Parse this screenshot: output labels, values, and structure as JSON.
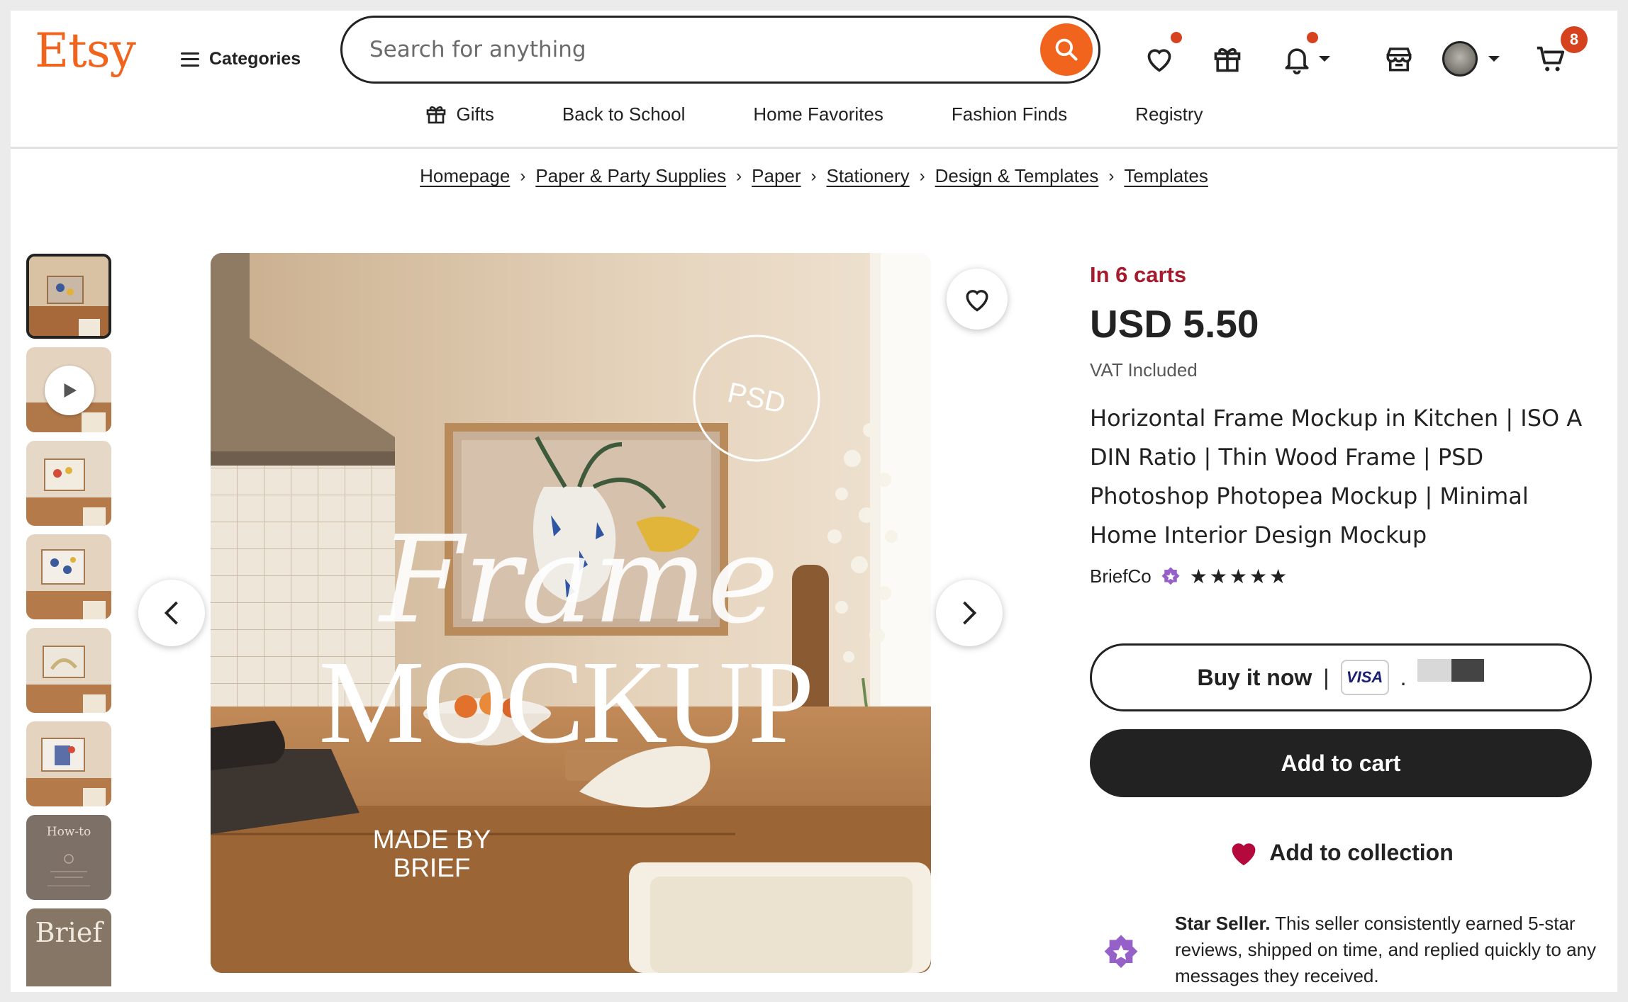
{
  "header": {
    "logo": "Etsy",
    "categories_label": "Categories",
    "search_placeholder": "Search for anything",
    "cart_count": "8"
  },
  "subnav": [
    "Gifts",
    "Back to School",
    "Home Favorites",
    "Fashion Finds",
    "Registry"
  ],
  "breadcrumb": [
    "Homepage",
    "Paper & Party Supplies",
    "Paper",
    "Stationery",
    "Design & Templates",
    "Templates"
  ],
  "listing": {
    "in_carts": "In 6 carts",
    "price": "USD 5.50",
    "vat": "VAT Included",
    "title": "Horizontal Frame Mockup in Kitchen | ISO A DIN Ratio | Thin Wood Frame | PSD Photoshop Photopea Mockup | Minimal Home Interior Design Mockup",
    "shop_name": "BriefCo",
    "rating_stars": 5,
    "buy_now_label": "Buy it now",
    "visa_label": "VISA",
    "add_to_cart_label": "Add to cart",
    "add_to_collection_label": "Add to collection",
    "star_seller_bold": "Star Seller.",
    "star_seller_text": " This seller consistently earned 5-star reviews, shipped on time, and replied quickly to any messages they received."
  },
  "image_overlay": {
    "psd": "PSD",
    "script": "Frame",
    "big": "MOCKUP",
    "made_by": "MADE BY\nBRIEF",
    "thumb7_text": "How-to",
    "thumb8_text": "Brief"
  },
  "colors": {
    "brand_orange": "#F1641E",
    "in_carts_red": "#A61A2E",
    "notification_dot": "#D6411E",
    "star_seller_purple": "#9560C8",
    "heart_red": "#B3093C"
  },
  "icons": [
    "hamburger-icon",
    "search-icon",
    "favorites-heart-icon",
    "gift-icon",
    "bell-icon",
    "shop-icon",
    "avatar",
    "cart-icon",
    "chevron-down-icon",
    "chevron-left-icon",
    "chevron-right-icon",
    "play-icon",
    "heart-icon",
    "star-seller-icon"
  ]
}
